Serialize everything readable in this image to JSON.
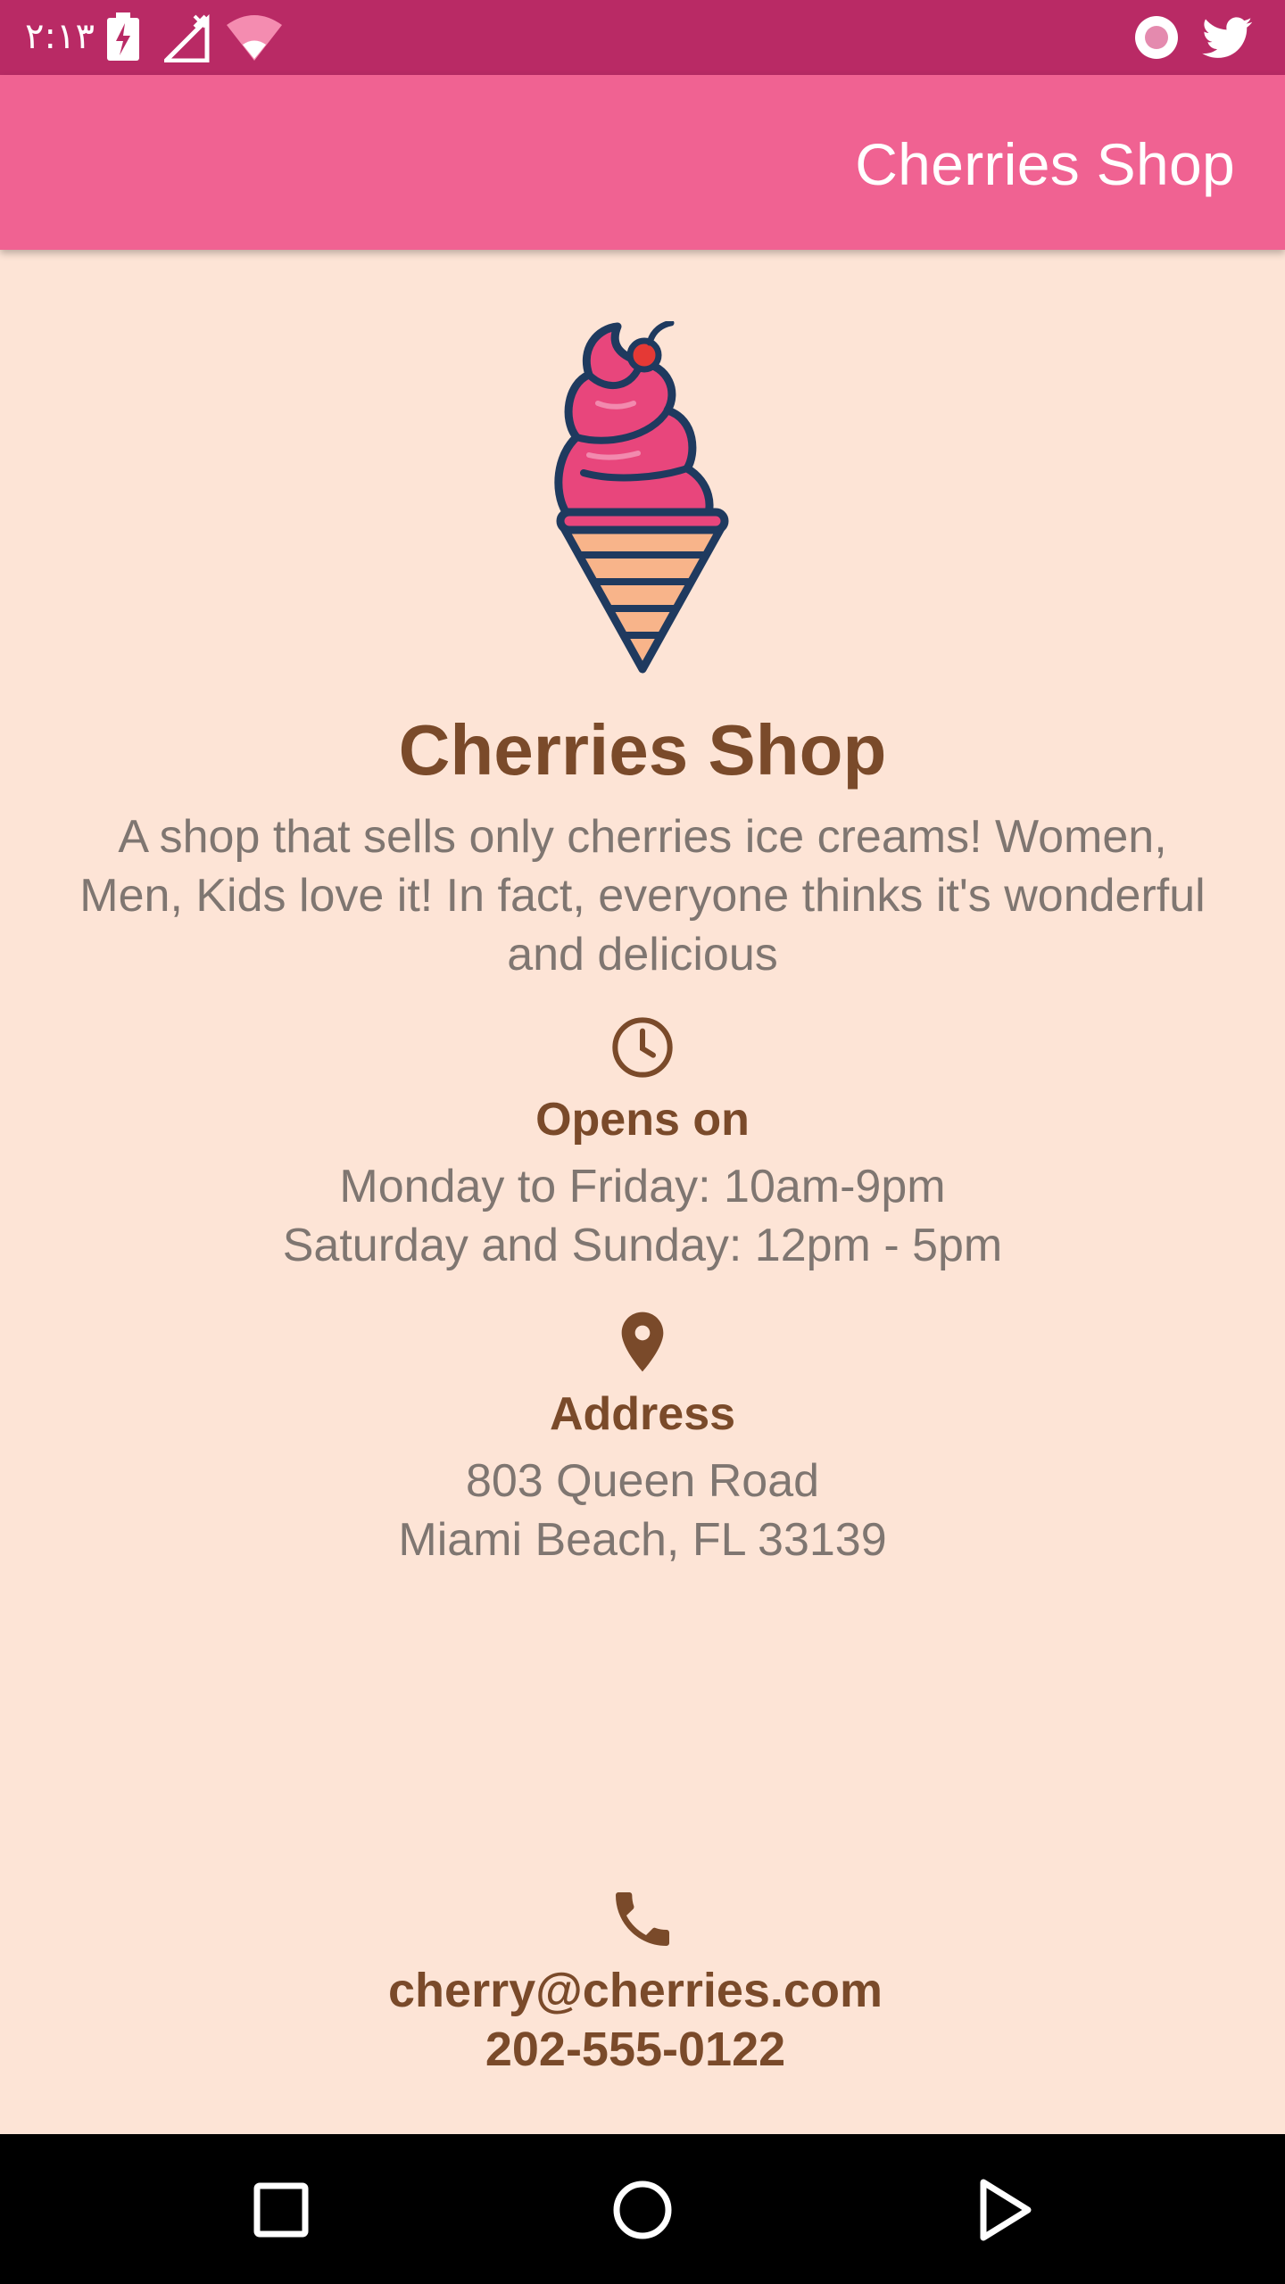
{
  "status_bar": {
    "time": "٢:١٣",
    "icons": [
      "battery-charging-icon",
      "no-signal-icon",
      "wifi-icon",
      "record-icon",
      "twitter-icon"
    ]
  },
  "app_bar": {
    "title": "Cherries Shop"
  },
  "shop": {
    "logo": "ice-cream-cone-icon",
    "name": "Cherries Shop",
    "description": "A shop that sells only cherries ice creams! Women, Men, Kids love it! In fact, everyone thinks it's wonderful and delicious"
  },
  "hours": {
    "icon": "clock-icon",
    "title": "Opens on",
    "lines": [
      "Monday to Friday: 10am-9pm",
      "Saturday and Sunday: 12pm - 5pm"
    ]
  },
  "address": {
    "icon": "location-pin-icon",
    "title": "Address",
    "lines": [
      "803 Queen Road",
      "Miami Beach, FL 33139"
    ]
  },
  "contact": {
    "icon": "phone-icon",
    "email": "cherry@cherries.com",
    "phone": "202-555-0122"
  },
  "nav_bar": {
    "buttons": [
      "recents-button",
      "home-button",
      "back-button"
    ]
  },
  "colors": {
    "status_bar": "#B92A65",
    "app_bar": "#F06292",
    "background": "#FDE4D6",
    "heading_brown": "#7A4A2A",
    "body_gray": "#7F7671"
  }
}
